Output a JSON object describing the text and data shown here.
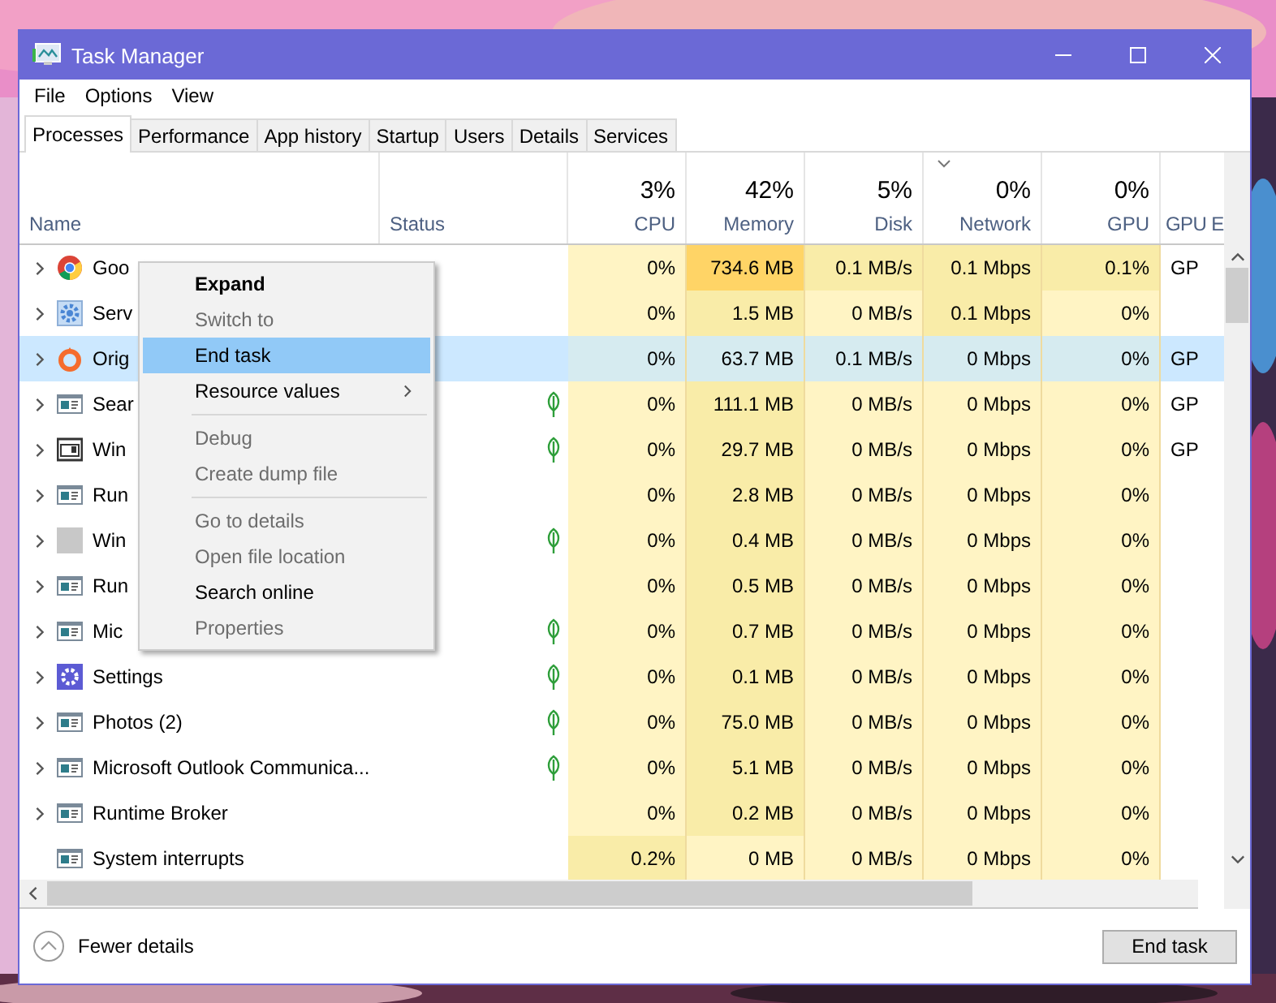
{
  "window": {
    "title": "Task Manager"
  },
  "menu": [
    "File",
    "Options",
    "View"
  ],
  "tabs": [
    {
      "label": "Processes",
      "selected": true
    },
    {
      "label": "Performance",
      "selected": false
    },
    {
      "label": "App history",
      "selected": false
    },
    {
      "label": "Startup",
      "selected": false
    },
    {
      "label": "Users",
      "selected": false
    },
    {
      "label": "Details",
      "selected": false
    },
    {
      "label": "Services",
      "selected": false
    }
  ],
  "columns": [
    {
      "kind": "plain",
      "label": "Name"
    },
    {
      "kind": "plain",
      "label": "Status"
    },
    {
      "kind": "metric",
      "usage": "3%",
      "label": "CPU",
      "sorted": false
    },
    {
      "kind": "metric",
      "usage": "42%",
      "label": "Memory",
      "sorted": false
    },
    {
      "kind": "metric",
      "usage": "5%",
      "label": "Disk",
      "sorted": false
    },
    {
      "kind": "metric",
      "usage": "0%",
      "label": "Network",
      "sorted": true
    },
    {
      "kind": "metric",
      "usage": "0%",
      "label": "GPU",
      "sorted": false
    },
    {
      "kind": "plain",
      "label": "GPU E"
    }
  ],
  "rows": [
    {
      "name": "Goo",
      "kind": "chrome",
      "expandable": true,
      "selected": false,
      "eco": false,
      "cells": [
        {
          "text": "0%",
          "color": "#fff4c4"
        },
        {
          "text": "734.6 MB",
          "color": "#ffd466"
        },
        {
          "text": "0.1 MB/s",
          "color": "#f9eca8"
        },
        {
          "text": "0.1 Mbps",
          "color": "#f9eca8"
        },
        {
          "text": "0.1%",
          "color": "#f9eca8"
        }
      ],
      "gpu_engine": "GP"
    },
    {
      "name": "Serv",
      "kind": "gear",
      "expandable": true,
      "selected": false,
      "eco": false,
      "cells": [
        {
          "text": "0%",
          "color": "#fff4c4"
        },
        {
          "text": "1.5 MB",
          "color": "#f9eca8"
        },
        {
          "text": "0 MB/s",
          "color": "#fff4c4"
        },
        {
          "text": "0.1 Mbps",
          "color": "#f9eca8"
        },
        {
          "text": "0%",
          "color": "#fff4c4"
        }
      ]
    },
    {
      "name": "Orig",
      "kind": "origin",
      "expandable": true,
      "selected": true,
      "eco": false,
      "cells": [
        {
          "text": "0%",
          "color": "#d6ebf0"
        },
        {
          "text": "63.7 MB",
          "color": "#d6ebf0"
        },
        {
          "text": "0.1 MB/s",
          "color": "#d6ebf0"
        },
        {
          "text": "0 Mbps",
          "color": "#d6ebf0"
        },
        {
          "text": "0%",
          "color": "#d6ebf0"
        }
      ],
      "gpu_engine": "GP"
    },
    {
      "name": "Sear",
      "kind": "app",
      "expandable": true,
      "selected": false,
      "eco": true,
      "cells": [
        {
          "text": "0%",
          "color": "#fff4c4"
        },
        {
          "text": "111.1 MB",
          "color": "#f9eca8"
        },
        {
          "text": "0 MB/s",
          "color": "#fff4c4"
        },
        {
          "text": "0 Mbps",
          "color": "#fff4c4"
        },
        {
          "text": "0%",
          "color": "#fff4c4"
        }
      ],
      "gpu_engine": "GP"
    },
    {
      "name": "Win",
      "kind": "window",
      "expandable": true,
      "selected": false,
      "eco": true,
      "cells": [
        {
          "text": "0%",
          "color": "#fff4c4"
        },
        {
          "text": "29.7 MB",
          "color": "#f9eca8"
        },
        {
          "text": "0 MB/s",
          "color": "#fff4c4"
        },
        {
          "text": "0 Mbps",
          "color": "#fff4c4"
        },
        {
          "text": "0%",
          "color": "#fff4c4"
        }
      ],
      "gpu_engine": "GP"
    },
    {
      "name": "Run",
      "kind": "app",
      "expandable": true,
      "selected": false,
      "eco": false,
      "cells": [
        {
          "text": "0%",
          "color": "#fff4c4"
        },
        {
          "text": "2.8 MB",
          "color": "#f9eca8"
        },
        {
          "text": "0 MB/s",
          "color": "#fff4c4"
        },
        {
          "text": "0 Mbps",
          "color": "#fff4c4"
        },
        {
          "text": "0%",
          "color": "#fff4c4"
        }
      ]
    },
    {
      "name": "Win",
      "kind": "blank",
      "expandable": true,
      "selected": false,
      "eco": true,
      "cells": [
        {
          "text": "0%",
          "color": "#fff4c4"
        },
        {
          "text": "0.4 MB",
          "color": "#f9eca8"
        },
        {
          "text": "0 MB/s",
          "color": "#fff4c4"
        },
        {
          "text": "0 Mbps",
          "color": "#fff4c4"
        },
        {
          "text": "0%",
          "color": "#fff4c4"
        }
      ]
    },
    {
      "name": "Run",
      "kind": "app",
      "expandable": true,
      "selected": false,
      "eco": false,
      "cells": [
        {
          "text": "0%",
          "color": "#fff4c4"
        },
        {
          "text": "0.5 MB",
          "color": "#f9eca8"
        },
        {
          "text": "0 MB/s",
          "color": "#fff4c4"
        },
        {
          "text": "0 Mbps",
          "color": "#fff4c4"
        },
        {
          "text": "0%",
          "color": "#fff4c4"
        }
      ]
    },
    {
      "name": "Mic",
      "kind": "app",
      "expandable": true,
      "selected": false,
      "eco": true,
      "cells": [
        {
          "text": "0%",
          "color": "#fff4c4"
        },
        {
          "text": "0.7 MB",
          "color": "#f9eca8"
        },
        {
          "text": "0 MB/s",
          "color": "#fff4c4"
        },
        {
          "text": "0 Mbps",
          "color": "#fff4c4"
        },
        {
          "text": "0%",
          "color": "#fff4c4"
        }
      ]
    },
    {
      "name": "Settings",
      "kind": "settings",
      "expandable": true,
      "selected": false,
      "eco": true,
      "cells": [
        {
          "text": "0%",
          "color": "#fff4c4"
        },
        {
          "text": "0.1 MB",
          "color": "#f9eca8"
        },
        {
          "text": "0 MB/s",
          "color": "#fff4c4"
        },
        {
          "text": "0 Mbps",
          "color": "#fff4c4"
        },
        {
          "text": "0%",
          "color": "#fff4c4"
        }
      ]
    },
    {
      "name": "Photos (2)",
      "kind": "app",
      "expandable": true,
      "selected": false,
      "eco": true,
      "cells": [
        {
          "text": "0%",
          "color": "#fff4c4"
        },
        {
          "text": "75.0 MB",
          "color": "#f9eca8"
        },
        {
          "text": "0 MB/s",
          "color": "#fff4c4"
        },
        {
          "text": "0 Mbps",
          "color": "#fff4c4"
        },
        {
          "text": "0%",
          "color": "#fff4c4"
        }
      ]
    },
    {
      "name": "Microsoft Outlook Communica...",
      "kind": "app",
      "expandable": true,
      "selected": false,
      "eco": true,
      "cells": [
        {
          "text": "0%",
          "color": "#fff4c4"
        },
        {
          "text": "5.1 MB",
          "color": "#f9eca8"
        },
        {
          "text": "0 MB/s",
          "color": "#fff4c4"
        },
        {
          "text": "0 Mbps",
          "color": "#fff4c4"
        },
        {
          "text": "0%",
          "color": "#fff4c4"
        }
      ]
    },
    {
      "name": "Runtime Broker",
      "kind": "app",
      "expandable": true,
      "selected": false,
      "eco": false,
      "cells": [
        {
          "text": "0%",
          "color": "#fff4c4"
        },
        {
          "text": "0.2 MB",
          "color": "#f9eca8"
        },
        {
          "text": "0 MB/s",
          "color": "#fff4c4"
        },
        {
          "text": "0 Mbps",
          "color": "#fff4c4"
        },
        {
          "text": "0%",
          "color": "#fff4c4"
        }
      ]
    },
    {
      "name": "System interrupts",
      "kind": "app",
      "expandable": false,
      "selected": false,
      "eco": false,
      "cells": [
        {
          "text": "0.2%",
          "color": "#f9eca8"
        },
        {
          "text": "0 MB",
          "color": "#fff4c4"
        },
        {
          "text": "0 MB/s",
          "color": "#fff4c4"
        },
        {
          "text": "0 Mbps",
          "color": "#fff4c4"
        },
        {
          "text": "0%",
          "color": "#fff4c4"
        }
      ]
    }
  ],
  "context_menu": {
    "items": [
      {
        "kind": "item",
        "label": "Expand",
        "bold": true,
        "disabled": false,
        "selected": false,
        "submenu": false
      },
      {
        "kind": "item",
        "label": "Switch to",
        "bold": false,
        "disabled": true,
        "selected": false,
        "submenu": false
      },
      {
        "kind": "item",
        "label": "End task",
        "bold": false,
        "disabled": false,
        "selected": true,
        "submenu": false
      },
      {
        "kind": "item",
        "label": "Resource values",
        "bold": false,
        "disabled": false,
        "selected": false,
        "submenu": true
      },
      {
        "kind": "separator"
      },
      {
        "kind": "item",
        "label": "Debug",
        "bold": false,
        "disabled": true,
        "selected": false,
        "submenu": false
      },
      {
        "kind": "item",
        "label": "Create dump file",
        "bold": false,
        "disabled": true,
        "selected": false,
        "submenu": false
      },
      {
        "kind": "separator"
      },
      {
        "kind": "item",
        "label": "Go to details",
        "bold": false,
        "disabled": true,
        "selected": false,
        "submenu": false
      },
      {
        "kind": "item",
        "label": "Open file location",
        "bold": false,
        "disabled": true,
        "selected": false,
        "submenu": false
      },
      {
        "kind": "item",
        "label": "Search online",
        "bold": false,
        "disabled": false,
        "selected": false,
        "submenu": false
      },
      {
        "kind": "item",
        "label": "Properties",
        "bold": false,
        "disabled": true,
        "selected": false,
        "submenu": false
      }
    ]
  },
  "footer": {
    "toggle": "Fewer details",
    "button": "End task"
  }
}
